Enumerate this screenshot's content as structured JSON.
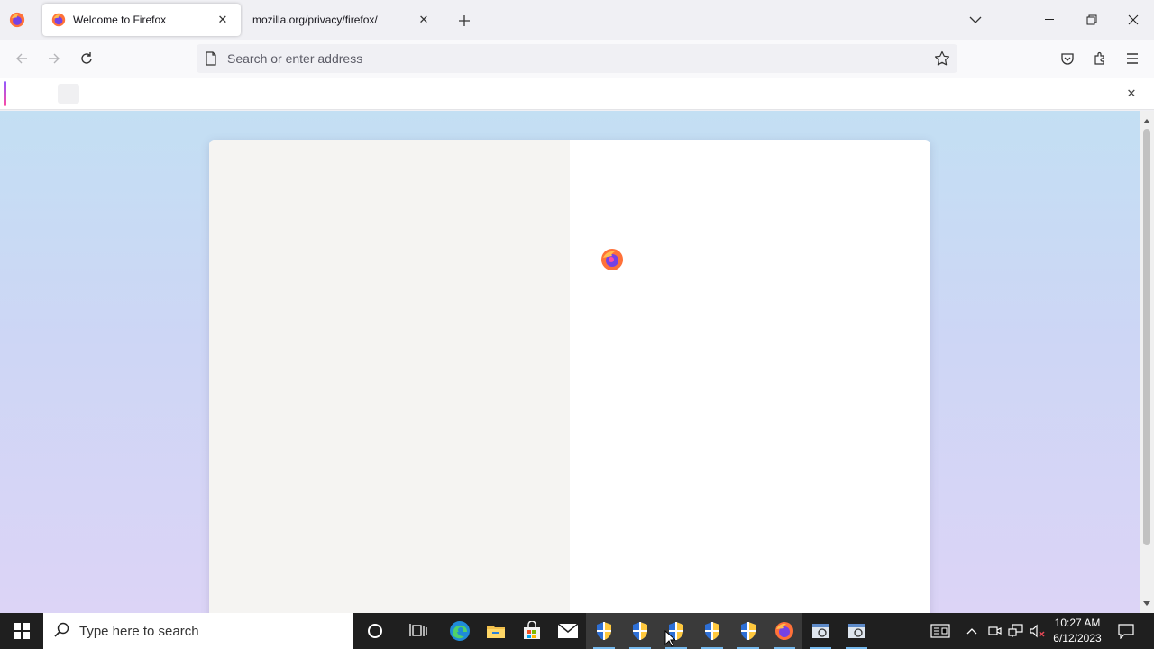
{
  "browser": {
    "tabs": [
      {
        "title": "Welcome to Firefox",
        "active": true
      },
      {
        "title": "mozilla.org/privacy/firefox/",
        "active": false
      }
    ],
    "new_tab_label": "+",
    "urlbar": {
      "placeholder": "Search or enter address"
    }
  },
  "taskbar": {
    "search_placeholder": "Type here to search",
    "clock": {
      "time": "10:27 AM",
      "date": "6/12/2023"
    },
    "pinned": [
      "cortana-icon",
      "task-view-icon",
      "edge-icon",
      "file-explorer-icon",
      "store-icon",
      "mail-icon",
      "shield-icon",
      "shield-icon",
      "shield-icon",
      "shield-icon",
      "shield-icon",
      "firefox-icon",
      "app-icon",
      "app-icon"
    ]
  },
  "colors": {
    "accent": "#76b9ed",
    "content_top": "#c3dff3",
    "content_bottom": "#dcd4f6"
  }
}
